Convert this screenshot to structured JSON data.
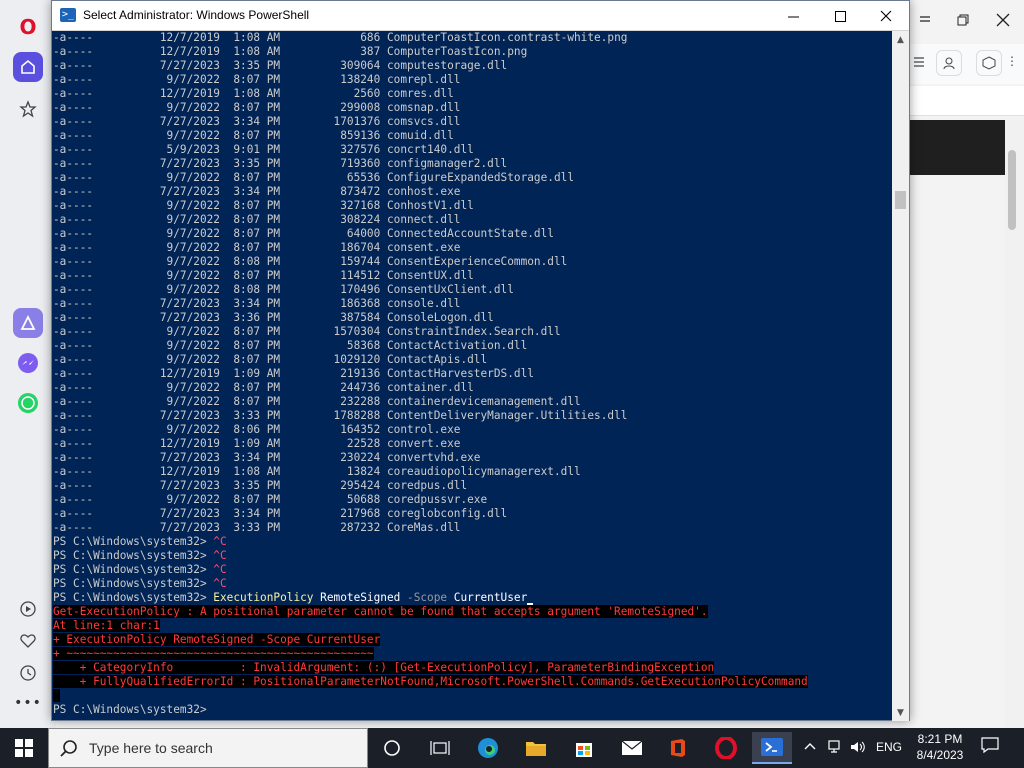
{
  "window": {
    "title": "Select Administrator: Windows PowerShell"
  },
  "console": {
    "file_listing": [
      {
        "mode": "-a----",
        "date": "12/7/2019",
        "time": "1:08 AM",
        "length": "686",
        "name": "ComputerToastIcon.contrast-white.png"
      },
      {
        "mode": "-a----",
        "date": "12/7/2019",
        "time": "1:08 AM",
        "length": "387",
        "name": "ComputerToastIcon.png"
      },
      {
        "mode": "-a----",
        "date": "7/27/2023",
        "time": "3:35 PM",
        "length": "309064",
        "name": "computestorage.dll"
      },
      {
        "mode": "-a----",
        "date": "9/7/2022",
        "time": "8:07 PM",
        "length": "138240",
        "name": "comrepl.dll"
      },
      {
        "mode": "-a----",
        "date": "12/7/2019",
        "time": "1:08 AM",
        "length": "2560",
        "name": "comres.dll"
      },
      {
        "mode": "-a----",
        "date": "9/7/2022",
        "time": "8:07 PM",
        "length": "299008",
        "name": "comsnap.dll"
      },
      {
        "mode": "-a----",
        "date": "7/27/2023",
        "time": "3:34 PM",
        "length": "1701376",
        "name": "comsvcs.dll"
      },
      {
        "mode": "-a----",
        "date": "9/7/2022",
        "time": "8:07 PM",
        "length": "859136",
        "name": "comuid.dll"
      },
      {
        "mode": "-a----",
        "date": "5/9/2023",
        "time": "9:01 PM",
        "length": "327576",
        "name": "concrt140.dll"
      },
      {
        "mode": "-a----",
        "date": "7/27/2023",
        "time": "3:35 PM",
        "length": "719360",
        "name": "configmanager2.dll"
      },
      {
        "mode": "-a----",
        "date": "9/7/2022",
        "time": "8:07 PM",
        "length": "65536",
        "name": "ConfigureExpandedStorage.dll"
      },
      {
        "mode": "-a----",
        "date": "7/27/2023",
        "time": "3:34 PM",
        "length": "873472",
        "name": "conhost.exe"
      },
      {
        "mode": "-a----",
        "date": "9/7/2022",
        "time": "8:07 PM",
        "length": "327168",
        "name": "ConhostV1.dll"
      },
      {
        "mode": "-a----",
        "date": "9/7/2022",
        "time": "8:07 PM",
        "length": "308224",
        "name": "connect.dll"
      },
      {
        "mode": "-a----",
        "date": "9/7/2022",
        "time": "8:07 PM",
        "length": "64000",
        "name": "ConnectedAccountState.dll"
      },
      {
        "mode": "-a----",
        "date": "9/7/2022",
        "time": "8:07 PM",
        "length": "186704",
        "name": "consent.exe"
      },
      {
        "mode": "-a----",
        "date": "9/7/2022",
        "time": "8:08 PM",
        "length": "159744",
        "name": "ConsentExperienceCommon.dll"
      },
      {
        "mode": "-a----",
        "date": "9/7/2022",
        "time": "8:07 PM",
        "length": "114512",
        "name": "ConsentUX.dll"
      },
      {
        "mode": "-a----",
        "date": "9/7/2022",
        "time": "8:08 PM",
        "length": "170496",
        "name": "ConsentUxClient.dll"
      },
      {
        "mode": "-a----",
        "date": "7/27/2023",
        "time": "3:34 PM",
        "length": "186368",
        "name": "console.dll"
      },
      {
        "mode": "-a----",
        "date": "7/27/2023",
        "time": "3:36 PM",
        "length": "387584",
        "name": "ConsoleLogon.dll"
      },
      {
        "mode": "-a----",
        "date": "9/7/2022",
        "time": "8:07 PM",
        "length": "1570304",
        "name": "ConstraintIndex.Search.dll"
      },
      {
        "mode": "-a----",
        "date": "9/7/2022",
        "time": "8:07 PM",
        "length": "58368",
        "name": "ContactActivation.dll"
      },
      {
        "mode": "-a----",
        "date": "9/7/2022",
        "time": "8:07 PM",
        "length": "1029120",
        "name": "ContactApis.dll"
      },
      {
        "mode": "-a----",
        "date": "12/7/2019",
        "time": "1:09 AM",
        "length": "219136",
        "name": "ContactHarvesterDS.dll"
      },
      {
        "mode": "-a----",
        "date": "9/7/2022",
        "time": "8:07 PM",
        "length": "244736",
        "name": "container.dll"
      },
      {
        "mode": "-a----",
        "date": "9/7/2022",
        "time": "8:07 PM",
        "length": "232288",
        "name": "containerdevicemanagement.dll"
      },
      {
        "mode": "-a----",
        "date": "7/27/2023",
        "time": "3:33 PM",
        "length": "1788288",
        "name": "ContentDeliveryManager.Utilities.dll"
      },
      {
        "mode": "-a----",
        "date": "9/7/2022",
        "time": "8:06 PM",
        "length": "164352",
        "name": "control.exe"
      },
      {
        "mode": "-a----",
        "date": "12/7/2019",
        "time": "1:09 AM",
        "length": "22528",
        "name": "convert.exe"
      },
      {
        "mode": "-a----",
        "date": "7/27/2023",
        "time": "3:34 PM",
        "length": "230224",
        "name": "convertvhd.exe"
      },
      {
        "mode": "-a----",
        "date": "12/7/2019",
        "time": "1:08 AM",
        "length": "13824",
        "name": "coreaudiopolicymanagerext.dll"
      },
      {
        "mode": "-a----",
        "date": "7/27/2023",
        "time": "3:35 PM",
        "length": "295424",
        "name": "coredpus.dll"
      },
      {
        "mode": "-a----",
        "date": "9/7/2022",
        "time": "8:07 PM",
        "length": "50688",
        "name": "coredpussvr.exe"
      },
      {
        "mode": "-a----",
        "date": "7/27/2023",
        "time": "3:34 PM",
        "length": "217968",
        "name": "coreglobconfig.dll"
      },
      {
        "mode": "-a----",
        "date": "7/27/2023",
        "time": "3:33 PM",
        "length": "287232",
        "name": "CoreMas.dll"
      }
    ],
    "prompt": "PS C:\\Windows\\system32> ",
    "ctrl_c": "^C",
    "command": {
      "cmdlet": "ExecutionPolicy",
      "arg": "RemoteSigned",
      "param": "-Scope",
      "value": "CurrentUser"
    },
    "error_lines": [
      "Get-ExecutionPolicy : A positional parameter cannot be found that accepts argument 'RemoteSigned'.",
      "At line:1 char:1",
      "+ ExecutionPolicy RemoteSigned -Scope CurrentUser",
      "+ ~~~~~~~~~~~~~~~~~~~~~~~~~~~~~~~~~~~~~~~~~~~~~~",
      "    + CategoryInfo          : InvalidArgument: (:) [Get-ExecutionPolicy], ParameterBindingException",
      "    + FullyQualifiedErrorId : PositionalParameterNotFound,Microsoft.PowerShell.Commands.GetExecutionPolicyCommand"
    ]
  },
  "taskbar": {
    "search_placeholder": "Type here to search",
    "language": "ENG",
    "time": "8:21 PM",
    "date": "8/4/2023"
  },
  "colors": {
    "console_bg": "#012456",
    "error_red": "#ff3a3a",
    "cmdlet_yellow": "#f9f1a5",
    "opera_red": "#e0102a",
    "opera_accent": "#5b4fe0"
  }
}
